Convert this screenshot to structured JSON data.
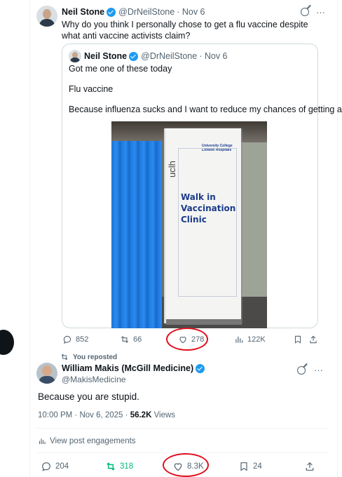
{
  "post": {
    "author_name": "Neil Stone",
    "author_handle": "@DrNeilStone",
    "date": "· Nov 6",
    "text": "Why do you think I personally chose to get a flu vaccine despite what anti vaccine activists claim?"
  },
  "quote": {
    "author_name": "Neil Stone",
    "author_handle": "@DrNeilStone",
    "date": "· Nov 6",
    "line1": "Got me one of these today",
    "line2": "Flu vaccine",
    "line3": "Because influenza sucks and I want to reduce my chances of getting a...",
    "image_text": {
      "brand": "University College London Hospitals",
      "side": "uclh",
      "sign": "Walk in Vaccination Clinic"
    }
  },
  "post_actions": {
    "replies": "852",
    "reposts": "66",
    "likes": "278",
    "views": "122K"
  },
  "reply": {
    "repost_label": "You reposted",
    "author_name": "William Makis (McGill Medicine)",
    "author_handle": "@MakisMedicine",
    "text": "Because you are stupid.",
    "time": "10:00 PM · Nov 6, 2025 · ",
    "views_count": "56.2K",
    "views_label": " Views",
    "engagements_label": "View post engagements"
  },
  "reply_actions": {
    "replies": "204",
    "reposts": "318",
    "likes": "8.3K",
    "bookmarks": "24"
  },
  "colors": {
    "text": "#0f1419",
    "muted": "#536471",
    "verified": "#1d9bf0",
    "repost_green": "#00ba7c",
    "annotation_red": "#e0101e"
  }
}
